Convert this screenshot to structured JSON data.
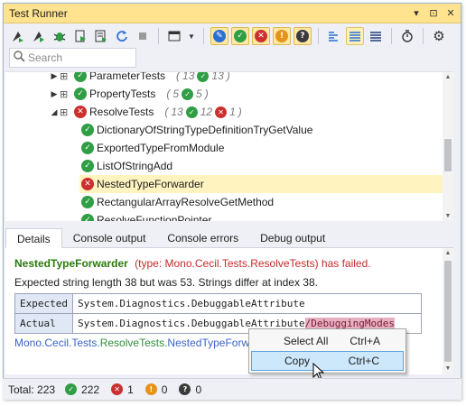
{
  "window": {
    "title": "Test Runner"
  },
  "titlebar": {
    "dropdown_icon": "▾",
    "pin_icon": "⊡",
    "close_icon": "✕"
  },
  "search": {
    "placeholder": "Search",
    "value": ""
  },
  "tree": {
    "rows": [
      {
        "name": "ParameterTests",
        "status": "passed",
        "total": "13",
        "passed": "13",
        "failed": ""
      },
      {
        "name": "PropertyTests",
        "status": "passed",
        "total": "5",
        "passed": "5",
        "failed": ""
      },
      {
        "name": "ResolveTests",
        "status": "failed",
        "total": "13",
        "passed": "12",
        "failed": "1"
      },
      {
        "name": "DictionaryOfStringTypeDefinitionTryGetValue",
        "status": "passed"
      },
      {
        "name": "ExportedTypeFromModule",
        "status": "passed"
      },
      {
        "name": "ListOfStringAdd",
        "status": "passed"
      },
      {
        "name": "NestedTypeForwarder",
        "status": "failed"
      },
      {
        "name": "RectangularArrayResolveGetMethod",
        "status": "passed"
      },
      {
        "name": "ResolveFunctionPointer",
        "status": "passed"
      }
    ]
  },
  "tabs": [
    "Details",
    "Console output",
    "Console errors",
    "Debug output"
  ],
  "details": {
    "test_name": "NestedTypeForwarder",
    "fail_message": "(type: Mono.Cecil.Tests.ResolveTests) has failed.",
    "detail": "Expected string length 38 but was 53. Strings differ at index 38.",
    "expected_label": "Expected",
    "actual_label": "Actual",
    "expected_value": "System.Diagnostics.DebuggableAttribute",
    "actual_value_prefix": "System.Diagnostics.DebuggableAttribute",
    "actual_value_diff": "/DebuggingModes",
    "breadcrumb": {
      "ns1": "Mono.",
      "ns2": "Cecil.",
      "ns3": "Tests.",
      "cls": "ResolveTests.",
      "method": "NestedTypeForwar"
    }
  },
  "context_menu": {
    "items": [
      {
        "label": "Select All",
        "shortcut": "Ctrl+A"
      },
      {
        "label": "Copy",
        "shortcut": "Ctrl+C"
      }
    ]
  },
  "status": {
    "total_label": "Total: 223",
    "passed": "222",
    "failed": "1",
    "ignored": "0",
    "inconclusive": "0"
  },
  "colors": {
    "titlebar": "#ffe38f",
    "passed": "#2f9e44",
    "failed": "#cc2f2f",
    "ignored": "#e59319",
    "selection": "#fff3bf",
    "diff_highlight": "#e6b0c3"
  }
}
